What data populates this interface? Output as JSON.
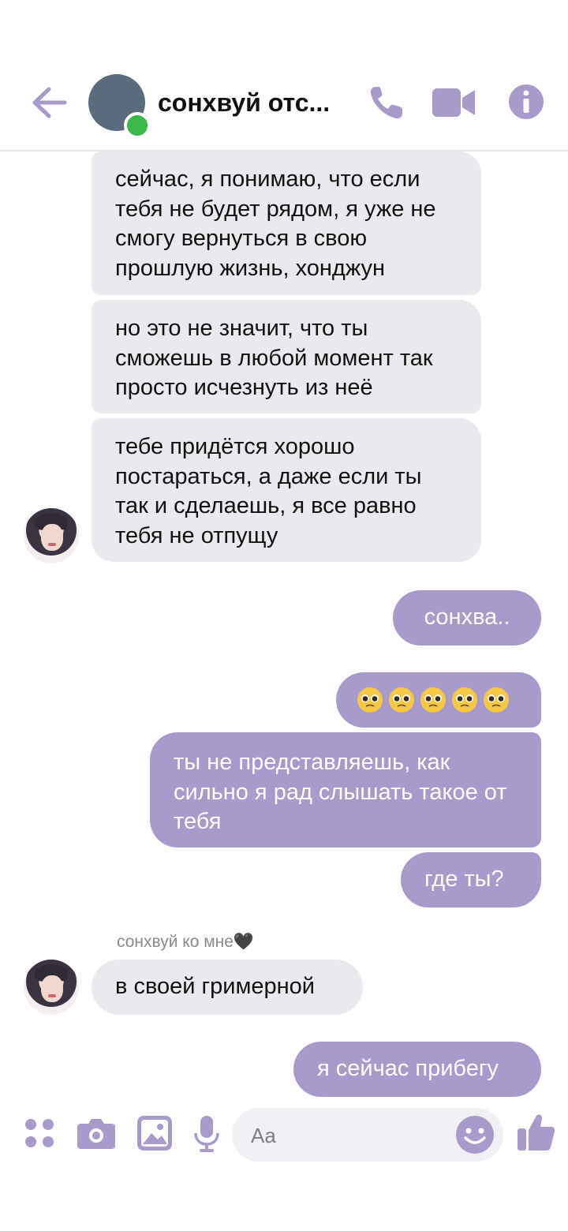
{
  "header": {
    "back_icon": "arrow-left-icon",
    "contact_name": "сонхвуй отс...",
    "status": "online",
    "call_icon": "phone-icon",
    "video_icon": "video-camera-icon",
    "info_icon": "info-icon",
    "accent_color": "#a89bcc"
  },
  "messages": {
    "m1": "сейчас, я понимаю, что если тебя не будет рядом, я уже не смогу вернуться в свою прошлую жизнь, хонджун",
    "m2": "но это не значит, что ты сможешь в любой момент так просто исчезнуть из неё",
    "m3": "тебе придётся хорошо постараться, а даже если ты так и сделаешь, я все равно тебя не отпущу",
    "m4": "сонхва..",
    "m5_emoji": "🥺🥺🥺🥺🥺",
    "m6": "ты не представляешь, как сильно я рад слышать такое от тебя",
    "m7": "где ты?",
    "sender_label": "сонхвуй ко мне🖤",
    "m8": "в своей гримерной",
    "m9": "я сейчас прибегу"
  },
  "colors": {
    "incoming_bubble": "#eae9ee",
    "outgoing_bubble": "#a89bcc",
    "online_dot": "#3cb94a"
  },
  "composer": {
    "placeholder": "Aa",
    "apps_icon": "apps-grid-icon",
    "camera_icon": "camera-icon",
    "gallery_icon": "image-icon",
    "mic_icon": "microphone-icon",
    "emoji_icon": "smiley-icon",
    "like_icon": "thumbs-up-icon"
  }
}
